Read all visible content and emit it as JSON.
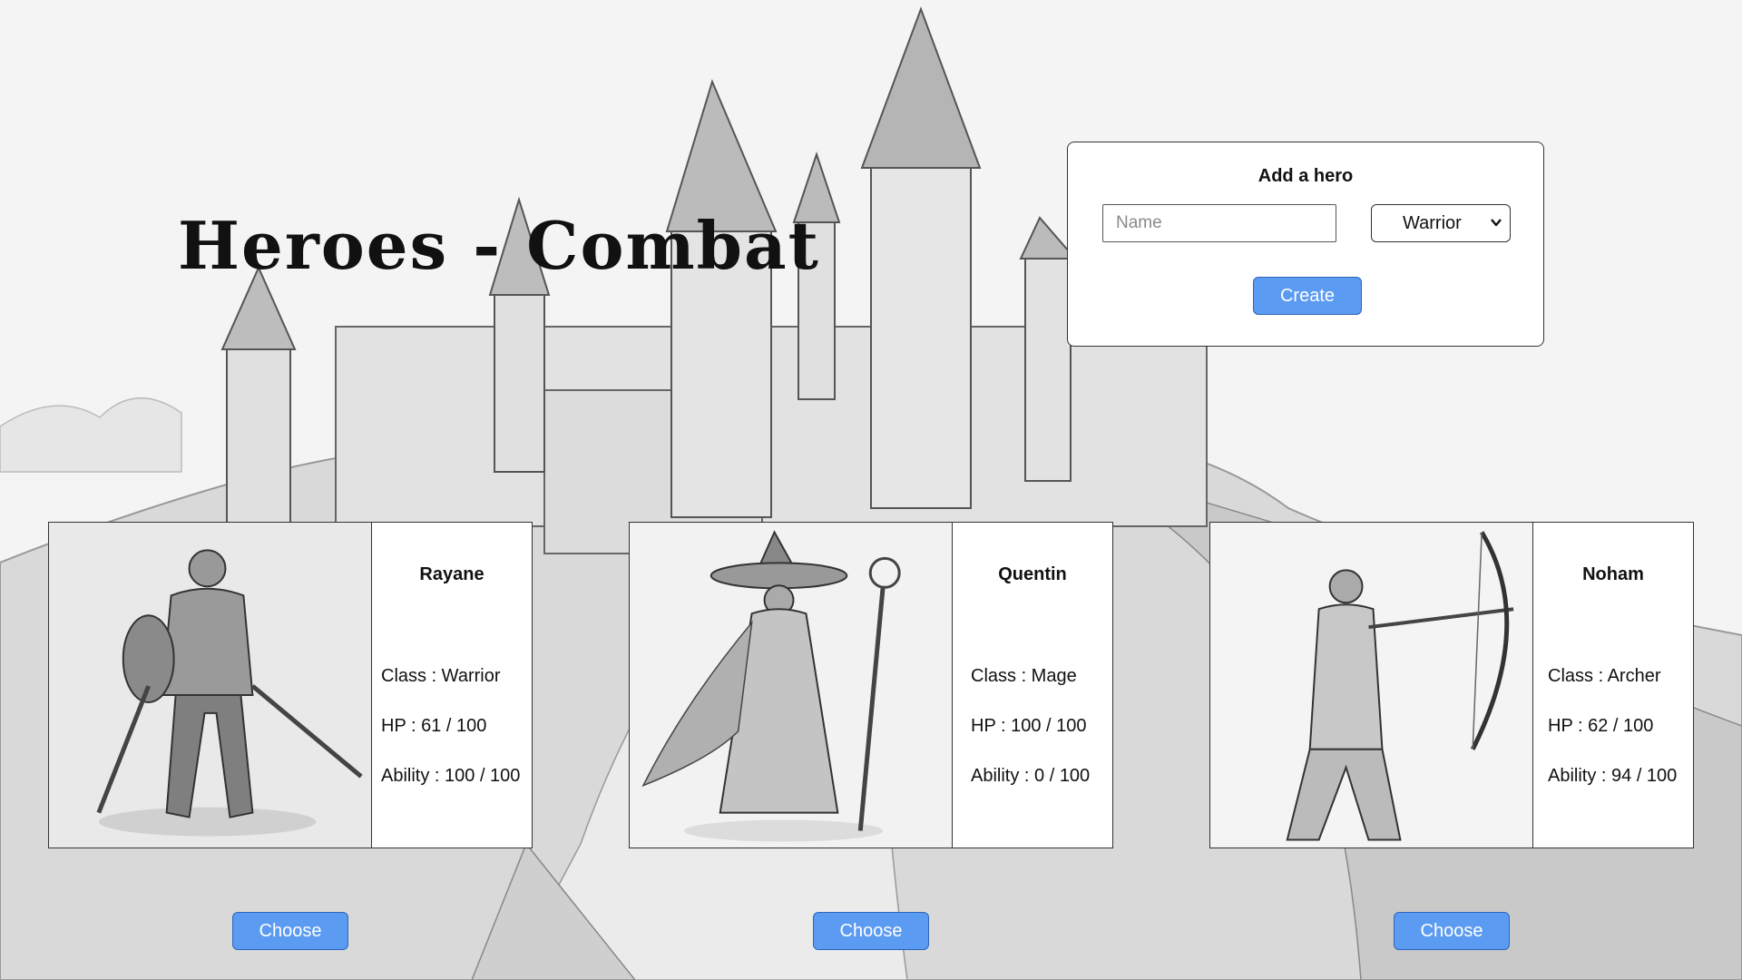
{
  "page": {
    "title": "Heroes - Combat"
  },
  "add_hero": {
    "heading": "Add a hero",
    "name_placeholder": "Name",
    "name_value": "",
    "class_selected": "Warrior",
    "create_label": "Create"
  },
  "heroes": [
    {
      "name": "Rayane",
      "class_line": "Class : Warrior",
      "hp_line": "HP : 61 / 100",
      "ability_line": "Ability : 100 / 100",
      "portrait": "warrior-portrait"
    },
    {
      "name": "Quentin",
      "class_line": "Class : Mage",
      "hp_line": "HP : 100 / 100",
      "ability_line": "Ability : 0 / 100",
      "portrait": "mage-portrait"
    },
    {
      "name": "Noham",
      "class_line": "Class : Archer",
      "hp_line": "HP : 62 / 100",
      "ability_line": "Ability : 94 / 100",
      "portrait": "archer-portrait"
    }
  ],
  "choose_label": "Choose",
  "colors": {
    "button": "#5b9bf1",
    "button_border": "#2e66b8",
    "background": "#f3f3f3"
  }
}
